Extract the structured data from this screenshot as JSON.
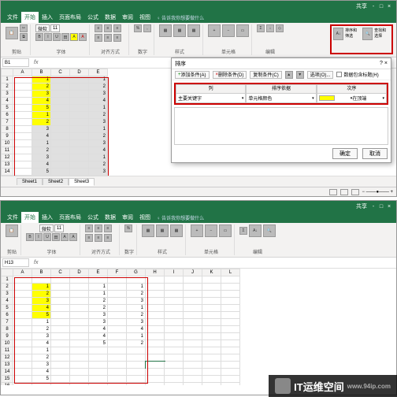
{
  "app": {
    "share": "共享",
    "tell": "告诉我你想要做什么"
  },
  "menu": {
    "file": "文件",
    "home": "开始",
    "insert": "插入",
    "layout": "页面布局",
    "formulas": "公式",
    "data": "数据",
    "review": "审阅",
    "view": "视图"
  },
  "ribbon": {
    "font": "微软",
    "size": "11",
    "g_clip": "剪贴",
    "g_font": "字体",
    "g_align": "对齐方式",
    "g_num": "数字",
    "g_style": "样式",
    "g_cell": "单元格",
    "g_edit": "编辑",
    "sort1": "排序和筛选",
    "sort2": "查找和选择"
  },
  "top": {
    "namebox": "B1",
    "cols": [
      "",
      "A",
      "B",
      "C",
      "D",
      "E"
    ],
    "rows": [
      1,
      2,
      3,
      4,
      5,
      6,
      7,
      8,
      9,
      10,
      11,
      12,
      13,
      14,
      15
    ],
    "data": {
      "B": {
        "1": "1",
        "2": "2",
        "3": "3",
        "4": "4",
        "5": "5",
        "6": "1",
        "7": "2",
        "8": "3",
        "9": "4",
        "10": "1",
        "11": "2",
        "12": "3",
        "13": "4",
        "14": "5"
      },
      "E": {
        "1": "1",
        "2": "2",
        "3": "3",
        "4": "4",
        "5": "1",
        "6": "2",
        "7": "3",
        "8": "1",
        "9": "2",
        "10": "3",
        "11": "4",
        "12": "1",
        "13": "2",
        "14": "3"
      }
    },
    "yellow": [
      "B1",
      "B2",
      "B3",
      "B4",
      "B5",
      "B6",
      "B7"
    ],
    "tabs": [
      "Sheet1",
      "Sheet2",
      "Sheet3"
    ],
    "active_tab": 2
  },
  "dialog": {
    "title": "排序",
    "qmark": "?",
    "close": "×",
    "add": "添加条件(A)",
    "del": "删除条件(D)",
    "copy": "复制条件(C)",
    "opts": "选项(O)...",
    "header": "数据包含标题(H)",
    "col_h": [
      "列",
      "排序依据",
      "次序"
    ],
    "row": {
      "c1": "主要关键字",
      "c2": "单元格颜色",
      "c3_after": "在顶端"
    },
    "ok": "确定",
    "cancel": "取消"
  },
  "bot": {
    "namebox": "H13",
    "cols": [
      "",
      "A",
      "B",
      "C",
      "D",
      "E",
      "F",
      "G",
      "H",
      "I",
      "J",
      "K",
      "L"
    ],
    "rows": [
      1,
      2,
      3,
      4,
      5,
      6,
      7,
      8,
      9,
      10,
      11,
      12,
      13,
      14,
      15,
      16
    ],
    "data": {
      "B": {
        "2": "1",
        "3": "2",
        "4": "3",
        "5": "4",
        "6": "5",
        "7": "1",
        "8": "2",
        "9": "3",
        "10": "4",
        "11": "1",
        "12": "2",
        "13": "3",
        "14": "4",
        "15": "5"
      },
      "E": {
        "2": "1",
        "3": "1",
        "4": "2",
        "5": "2",
        "6": "3",
        "7": "3",
        "8": "4",
        "9": "4",
        "10": "5"
      },
      "G": {
        "2": "1",
        "3": "2",
        "4": "3",
        "5": "1",
        "6": "2",
        "7": "3",
        "8": "4",
        "9": "1",
        "10": "2"
      }
    },
    "yellow": [
      "B2",
      "B3",
      "B4",
      "B5",
      "B6"
    ]
  },
  "watermark": {
    "text": "IT运维空间",
    "url": "www.94ip.com"
  }
}
